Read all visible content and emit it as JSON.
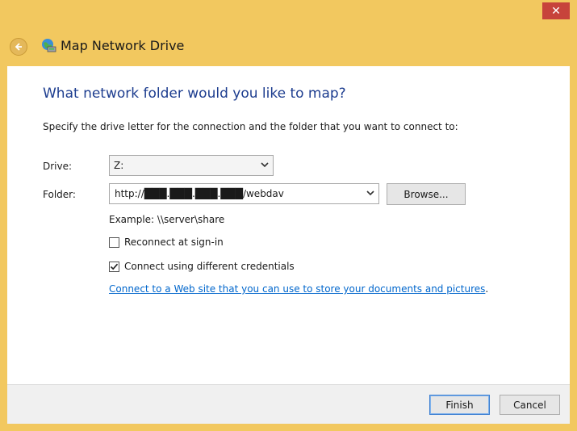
{
  "window": {
    "close_label": "✕"
  },
  "header": {
    "title": "Map Network Drive"
  },
  "main": {
    "question": "What network folder would you like to map?",
    "instruction": "Specify the drive letter for the connection and the folder that you want to connect to:",
    "drive_label": "Drive:",
    "drive_value": "Z:",
    "folder_label": "Folder:",
    "folder_value": "http://███.███.███.███/webdav",
    "browse_label": "Browse...",
    "example": "Example: \\\\server\\share",
    "reconnect_label": "Reconnect at sign-in",
    "reconnect_checked": false,
    "credentials_label": "Connect using different credentials",
    "credentials_checked": true,
    "link_text": "Connect to a Web site that you can use to store your documents and pictures",
    "link_suffix": "."
  },
  "footer": {
    "finish_label": "Finish",
    "cancel_label": "Cancel"
  },
  "colors": {
    "window_frame": "#f2c85f",
    "close_button": "#c7433b",
    "heading": "#1d3d8f",
    "link": "#0066cc"
  }
}
